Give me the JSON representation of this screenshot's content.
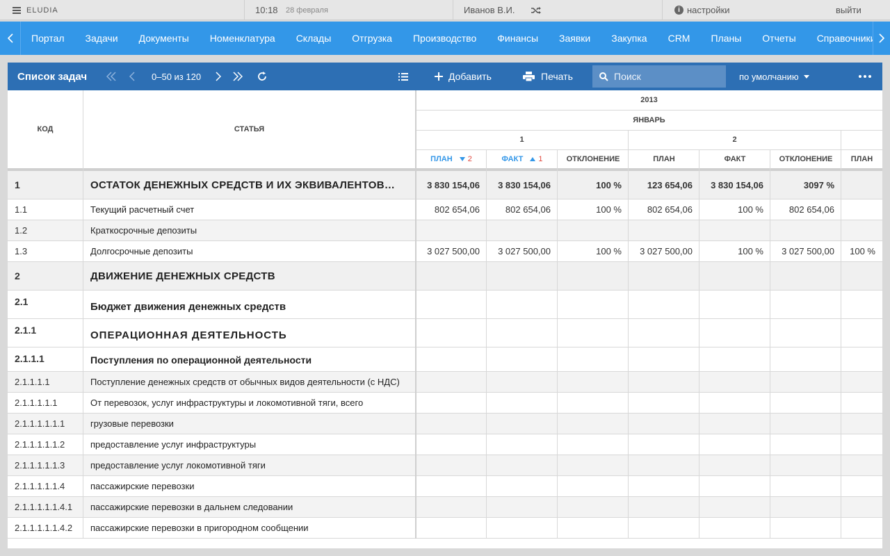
{
  "topbar": {
    "app_name": "ELUDIA",
    "time": "10:18",
    "date": "28 февраля",
    "user": "Иванов В.И.",
    "settings": "настройки",
    "logout": "выйти"
  },
  "nav": {
    "items": [
      "Портал",
      "Задачи",
      "Документы",
      "Номенклатура",
      "Склады",
      "Отгрузка",
      "Производство",
      "Финансы",
      "Заявки",
      "Закупка",
      "CRM",
      "Планы",
      "Отчеты",
      "Справочники"
    ]
  },
  "toolbar": {
    "title": "Список задач",
    "pager": "0–50 из 120",
    "add": "Добавить",
    "print": "Печать",
    "search_placeholder": "Поиск",
    "sort": "по умолчанию"
  },
  "table": {
    "head": {
      "code": "КОД",
      "article": "СТАТЬЯ",
      "year": "2013",
      "month": "ЯНВАРЬ",
      "day1": "1",
      "day2": "2",
      "cols": [
        "ПЛАН",
        "ФАКТ",
        "ОТКЛОНЕНИЕ",
        "ПЛАН",
        "ФАКТ",
        "ОТКЛОНЕНИЕ",
        "ПЛАН"
      ],
      "sort_plan_index": "2",
      "sort_fact_index": "1"
    },
    "rows": [
      {
        "code": "1",
        "label": "ОСТАТОК ДЕНЕЖНЫХ СРЕДСТВ И ИХ ЭКВИВАЛЕНТОВ…",
        "style": "section",
        "values": [
          "3 830 154,06",
          "3 830 154,06",
          "100 %",
          "123 654,06",
          "3 830 154,06",
          "3097 %",
          ""
        ]
      },
      {
        "code": "1.1",
        "label": "Текущий расчетный счет",
        "style": "plain",
        "values": [
          "802 654,06",
          "802 654,06",
          "100 %",
          "802 654,06",
          "100 %",
          "802 654,06",
          ""
        ]
      },
      {
        "code": "1.2",
        "label": "Краткосрочные депозиты",
        "style": "alt",
        "values": [
          "",
          "",
          "",
          "",
          "",
          "",
          ""
        ]
      },
      {
        "code": "1.3",
        "label": "Долгосрочные депозиты",
        "style": "plain",
        "values": [
          "3 027 500,00",
          "3 027 500,00",
          "100 %",
          "3 027 500,00",
          "100 %",
          "3 027 500,00",
          "100 %"
        ]
      },
      {
        "code": "2",
        "label": "ДВИЖЕНИЕ ДЕНЕЖНЫХ СРЕДСТВ",
        "style": "section",
        "values": [
          "",
          "",
          "",
          "",
          "",
          "",
          ""
        ]
      },
      {
        "code": "2.1",
        "label": "Бюджет движения денежных средств",
        "style": "bold",
        "values": [
          "",
          "",
          "",
          "",
          "",
          "",
          ""
        ]
      },
      {
        "code": "2.1.1",
        "label": "ОПЕРАЦИОННАЯ ДЕЯТЕЛЬНОСТЬ",
        "style": "caps",
        "values": [
          "",
          "",
          "",
          "",
          "",
          "",
          ""
        ]
      },
      {
        "code": "2.1.1.1",
        "label": "Поступления по операционной деятельности",
        "style": "bold2",
        "values": [
          "",
          "",
          "",
          "",
          "",
          "",
          ""
        ]
      },
      {
        "code": "2.1.1.1.1",
        "label": "Поступление денежных средств от обычных видов деятельности (с НДС)",
        "style": "alt",
        "values": [
          "",
          "",
          "",
          "",
          "",
          "",
          ""
        ]
      },
      {
        "code": "2.1.1.1.1.1",
        "label": "От перевозок, услуг инфраструктуры и локомотивной тяги, всего",
        "style": "plain",
        "values": [
          "",
          "",
          "",
          "",
          "",
          "",
          ""
        ]
      },
      {
        "code": "2.1.1.1.1.1.1",
        "label": "грузовые перевозки",
        "style": "alt",
        "values": [
          "",
          "",
          "",
          "",
          "",
          "",
          ""
        ]
      },
      {
        "code": "2.1.1.1.1.1.2",
        "label": "предоставление услуг инфраструктуры",
        "style": "plain",
        "values": [
          "",
          "",
          "",
          "",
          "",
          "",
          ""
        ]
      },
      {
        "code": "2.1.1.1.1.1.3",
        "label": "предоставление услуг локомотивной тяги",
        "style": "alt",
        "values": [
          "",
          "",
          "",
          "",
          "",
          "",
          ""
        ]
      },
      {
        "code": "2.1.1.1.1.1.4",
        "label": "пассажирские перевозки",
        "style": "plain",
        "values": [
          "",
          "",
          "",
          "",
          "",
          "",
          ""
        ]
      },
      {
        "code": "2.1.1.1.1.1.4.1",
        "label": "пассажирские перевозки в дальнем следовании",
        "style": "alt",
        "values": [
          "",
          "",
          "",
          "",
          "",
          "",
          ""
        ]
      },
      {
        "code": "2.1.1.1.1.1.4.2",
        "label": "пассажирские перевозки в пригородном сообщении",
        "style": "plain",
        "values": [
          "",
          "",
          "",
          "",
          "",
          "",
          ""
        ]
      }
    ]
  },
  "colors": {
    "accent": "#3397e8",
    "toolbar": "#2d6fb4",
    "section_bg": "#f0f0f0",
    "sort_red": "#e0483e"
  },
  "icons": [
    "list-icon",
    "chevron-left-icon",
    "chevron-right-icon",
    "double-chevron-left-icon",
    "double-chevron-right-icon",
    "refresh-icon",
    "columns-icon",
    "plus-icon",
    "print-icon",
    "search-icon",
    "more-icon",
    "shuffle-icon",
    "info-icon"
  ]
}
